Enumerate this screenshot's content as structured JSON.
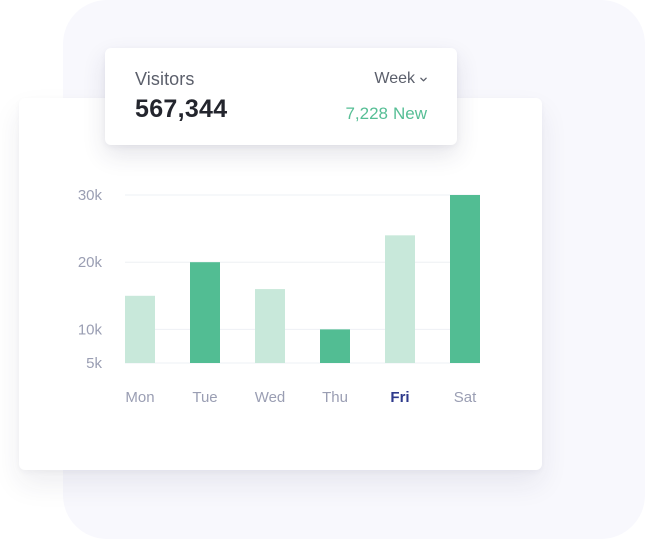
{
  "widget": {
    "title": "Visitors",
    "total": "567,344",
    "period_selected": "Week",
    "new_count": "7,228",
    "new_label": "New"
  },
  "colors": {
    "bar_active": "#52bd93",
    "bar_inactive": "#c8e8da",
    "tick_text": "#9a9eb3",
    "highlight_label": "#2e3a8c",
    "gridline": "#eef0f4"
  },
  "chart_data": {
    "type": "bar",
    "categories": [
      "Mon",
      "Tue",
      "Wed",
      "Thu",
      "Fri",
      "Sat"
    ],
    "values": [
      15000,
      20000,
      16000,
      10000,
      24000,
      30000
    ],
    "emphasized": [
      false,
      true,
      false,
      true,
      false,
      true
    ],
    "highlighted_category": "Fri",
    "y_ticks": [
      {
        "value": 5000,
        "label": "5k"
      },
      {
        "value": 10000,
        "label": "10k"
      },
      {
        "value": 20000,
        "label": "20k"
      },
      {
        "value": 30000,
        "label": "30k"
      }
    ],
    "ylim": [
      0,
      30000
    ],
    "grid": true,
    "legend": "none"
  }
}
